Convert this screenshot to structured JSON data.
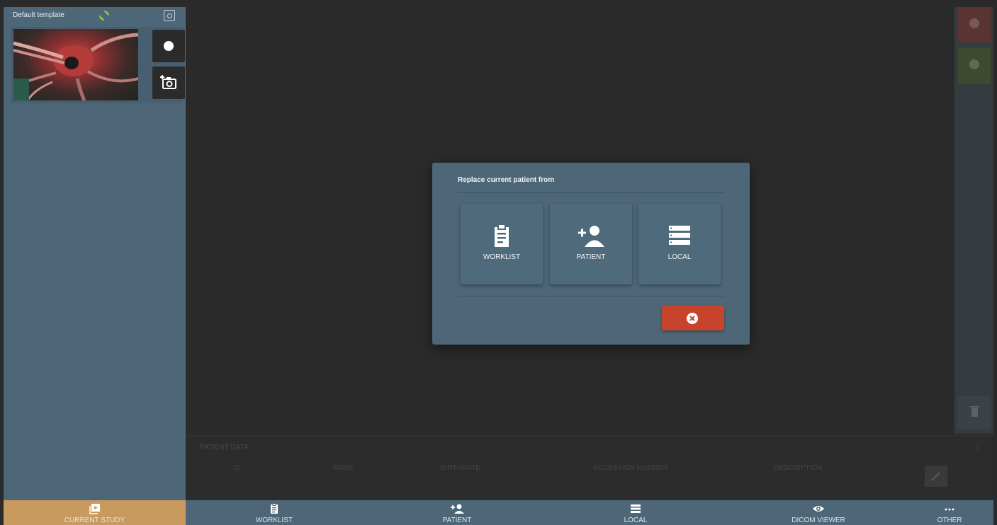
{
  "left_panel": {
    "template_name": "Default template"
  },
  "dialog": {
    "title": "Replace current patient from",
    "options": [
      {
        "label": "WORKLIST",
        "icon": "clipboard-icon"
      },
      {
        "label": "PATIENT",
        "icon": "add-person-icon"
      },
      {
        "label": "LOCAL",
        "icon": "storage-list-icon"
      }
    ],
    "cancel_icon": "close-circle-icon"
  },
  "patient_strip": {
    "title": "PATIENT DATA",
    "columns": [
      "ID",
      "NAME",
      "BIRTHDATE",
      "ACCESSION NUMBER",
      "DESCRIPTION"
    ]
  },
  "bottom_nav": {
    "items": [
      {
        "label": "CURRENT STUDY",
        "icon": "current-study-icon",
        "active": true
      },
      {
        "label": "WORKLIST",
        "icon": "clipboard-icon"
      },
      {
        "label": "PATIENT",
        "icon": "add-person-icon"
      },
      {
        "label": "LOCAL",
        "icon": "list-icon"
      },
      {
        "label": "DICOM VIEWER",
        "icon": "eye-icon"
      },
      {
        "label": "OTHER",
        "icon": "more-icon"
      }
    ]
  },
  "colors": {
    "panel": "#4d6778",
    "background": "#2a2a2a",
    "accent_current": "#c89a5e",
    "cancel": "#c8432c",
    "sync_icon": "#8dc63f"
  }
}
